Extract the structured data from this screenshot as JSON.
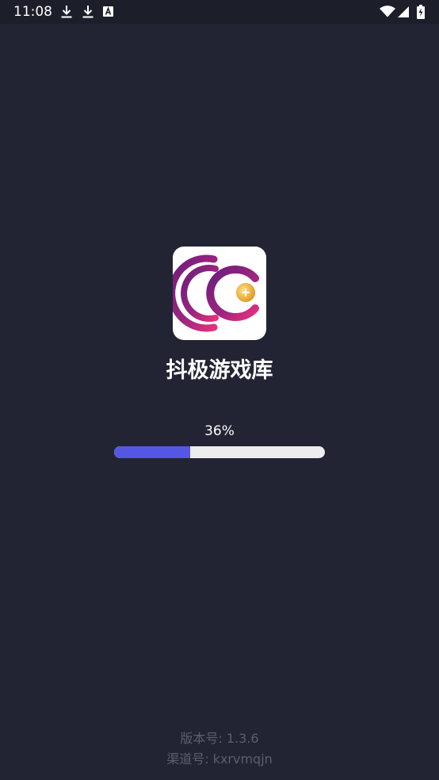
{
  "status_bar": {
    "time": "11:08",
    "left_icons": [
      "download-icon",
      "download-icon",
      "text-a-icon"
    ],
    "right_icons": [
      "wifi-icon",
      "cell-signal-icon",
      "battery-charging-icon"
    ]
  },
  "app": {
    "icon": "app-logo-icon",
    "title": "抖极游戏库"
  },
  "progress": {
    "label": "36%",
    "value": 0.36
  },
  "footer": {
    "version": "版本号: 1.3.6",
    "channel": "渠道号: kxrvmqjn"
  },
  "colors": {
    "background": "#222433",
    "progress_fill": "#5457e4",
    "progress_track": "#ededf0",
    "footer_text": "#5b5e6e",
    "logo_gradient_start": "#6a1e7c",
    "logo_gradient_end": "#e5307f",
    "logo_coin": "#f2b232"
  }
}
